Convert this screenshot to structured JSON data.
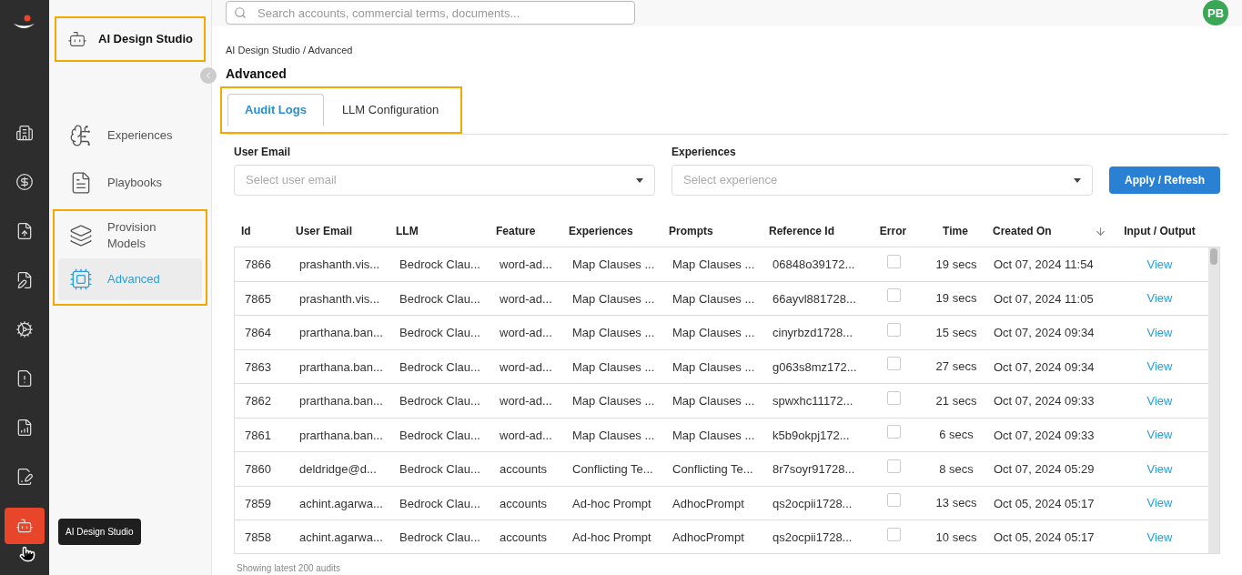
{
  "rail": {
    "items": [
      {
        "selected": false
      },
      {
        "selected": false
      },
      {
        "selected": false
      },
      {
        "selected": false
      },
      {
        "selected": false
      },
      {
        "selected": false
      },
      {
        "selected": false
      },
      {
        "selected": false
      },
      {
        "selected": true
      }
    ],
    "tooltip": "AI Design Studio"
  },
  "sidebar": {
    "title": "AI Design Studio",
    "title_highlighted": true,
    "items": [
      {
        "label": "Experiences",
        "selected": false,
        "highlighted": false
      },
      {
        "label": "Playbooks",
        "selected": false,
        "highlighted": false
      },
      {
        "label": "Provision Models",
        "selected": false,
        "highlighted": true
      },
      {
        "label": "Advanced",
        "selected": true,
        "highlighted": true
      }
    ]
  },
  "search": {
    "placeholder": "Search accounts, commercial terms, documents..."
  },
  "avatar": "PB",
  "breadcrumb": "AI Design Studio / Advanced",
  "page_title": "Advanced",
  "tabs_highlighted": true,
  "tabs": [
    {
      "label": "Audit Logs",
      "selected": true
    },
    {
      "label": "LLM Configuration",
      "selected": false
    }
  ],
  "filters": [
    {
      "label": "User Email",
      "placeholder": "Select user email"
    },
    {
      "label": "Experiences",
      "placeholder": "Select experience"
    }
  ],
  "apply_button": "Apply / Refresh",
  "table": {
    "columns": [
      "Id",
      "User Email",
      "LLM",
      "Feature",
      "Experiences",
      "Prompts",
      "Reference Id",
      "Error",
      "Time",
      "Created On",
      "Input / Output"
    ],
    "rows": [
      {
        "cells": [
          "7866",
          "prashanth.vis...",
          "Bedrock Clau...",
          "word-ad...",
          "Map Clauses ...",
          "Map Clauses ...",
          "06848o39172...",
          "",
          "19 secs",
          "Oct 07, 2024 11:54",
          "View"
        ],
        "error": false
      },
      {
        "cells": [
          "7865",
          "prashanth.vis...",
          "Bedrock Clau...",
          "word-ad...",
          "Map Clauses ...",
          "Map Clauses ...",
          "66ayvl881728...",
          "",
          "19 secs",
          "Oct 07, 2024 11:05",
          "View"
        ],
        "error": false
      },
      {
        "cells": [
          "7864",
          "prarthana.ban...",
          "Bedrock Clau...",
          "word-ad...",
          "Map Clauses ...",
          "Map Clauses ...",
          "cinyrbzd1728...",
          "",
          "15 secs",
          "Oct 07, 2024 09:34",
          "View"
        ],
        "error": false
      },
      {
        "cells": [
          "7863",
          "prarthana.ban...",
          "Bedrock Clau...",
          "word-ad...",
          "Map Clauses ...",
          "Map Clauses ...",
          "g063s8mz172...",
          "",
          "27 secs",
          "Oct 07, 2024 09:34",
          "View"
        ],
        "error": false
      },
      {
        "cells": [
          "7862",
          "prarthana.ban...",
          "Bedrock Clau...",
          "word-ad...",
          "Map Clauses ...",
          "Map Clauses ...",
          "spwxhc11172...",
          "",
          "21 secs",
          "Oct 07, 2024 09:33",
          "View"
        ],
        "error": false
      },
      {
        "cells": [
          "7861",
          "prarthana.ban...",
          "Bedrock Clau...",
          "word-ad...",
          "Map Clauses ...",
          "Map Clauses ...",
          "k5b9okpj172...",
          "",
          "6 secs",
          "Oct 07, 2024 09:33",
          "View"
        ],
        "error": false
      },
      {
        "cells": [
          "7860",
          "deldridge@d...",
          "Bedrock Clau...",
          "accounts",
          "Conflicting Te...",
          "Conflicting Te...",
          "8r7soyr91728...",
          "",
          "8 secs",
          "Oct 07, 2024 05:29",
          "View"
        ],
        "error": false
      },
      {
        "cells": [
          "7859",
          "achint.agarwa...",
          "Bedrock Clau...",
          "accounts",
          "Ad-hoc Prompt",
          "AdhocPrompt",
          "qs2ocpii1728...",
          "",
          "13 secs",
          "Oct 05, 2024 05:17",
          "View"
        ],
        "error": false
      },
      {
        "cells": [
          "7858",
          "achint.agarwa...",
          "Bedrock Clau...",
          "accounts",
          "Ad-hoc Prompt",
          "AdhocPrompt",
          "qs2ocpii1728...",
          "",
          "10 secs",
          "Oct 05, 2024 05:17",
          "View"
        ],
        "error": false
      }
    ]
  },
  "footer": "Showing latest 200 audits"
}
